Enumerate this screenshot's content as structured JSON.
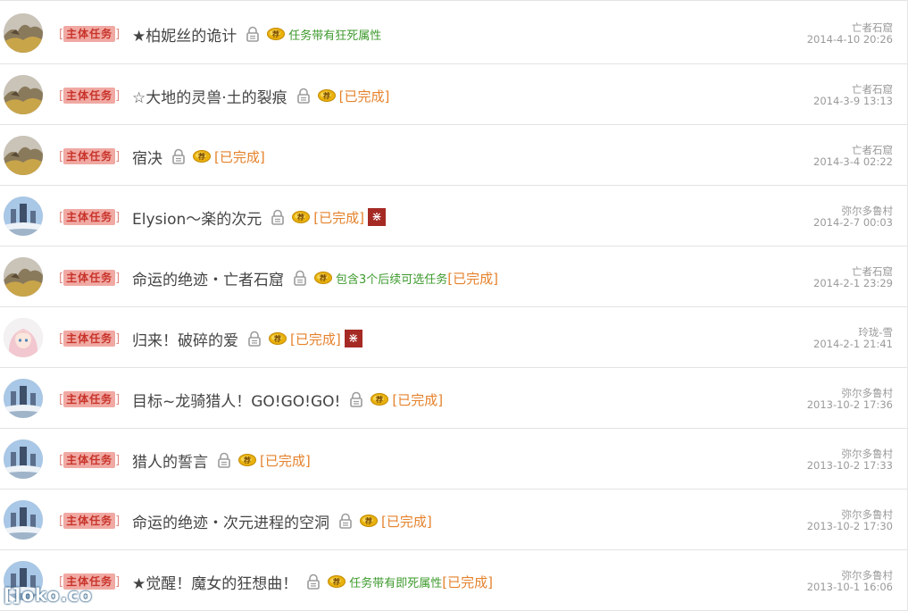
{
  "quests": [
    {
      "tag": "主体任务",
      "title": "★柏妮丝的诡计",
      "note": "任务带有狂死属性",
      "done": "",
      "flag": "",
      "location": "亡者石窟",
      "date": "2014-4-10 20:26",
      "avatar": "rock"
    },
    {
      "tag": "主体任务",
      "title": "☆大地的灵兽·土的裂痕",
      "note": "",
      "done": "[已完成]",
      "flag": "",
      "location": "亡者石窟",
      "date": "2014-3-9 13:13",
      "avatar": "rock"
    },
    {
      "tag": "主体任务",
      "title": "宿决",
      "note": "",
      "done": "[已完成]",
      "flag": "",
      "location": "亡者石窟",
      "date": "2014-3-4 02:22",
      "avatar": "rock"
    },
    {
      "tag": "主体任务",
      "title": "Elysion～楽的次元",
      "note": "",
      "done": "[已完成]",
      "flag": "⋇",
      "location": "弥尔多鲁村",
      "date": "2014-2-7 00:03",
      "avatar": "castle"
    },
    {
      "tag": "主体任务",
      "title": "命运的绝迹・亡者石窟",
      "note": "包含3个后续可选任务",
      "done": "[已完成]",
      "flag": "",
      "location": "亡者石窟",
      "date": "2014-2-1 23:29",
      "avatar": "rock"
    },
    {
      "tag": "主体任务",
      "title": "归来！破碎的爱",
      "note": "",
      "done": "[已完成]",
      "flag": "⋇",
      "location": "玲珑-雪",
      "date": "2014-2-1 21:41",
      "avatar": "girl"
    },
    {
      "tag": "主体任务",
      "title": "目标~龙骑猎人！GO!GO!GO!",
      "note": "",
      "done": "[已完成]",
      "flag": "",
      "location": "弥尔多鲁村",
      "date": "2013-10-2 17:36",
      "avatar": "castle"
    },
    {
      "tag": "主体任务",
      "title": "猎人的誓言",
      "note": "",
      "done": "[已完成]",
      "flag": "",
      "location": "弥尔多鲁村",
      "date": "2013-10-2 17:33",
      "avatar": "castle"
    },
    {
      "tag": "主体任务",
      "title": "命运的绝迹・次元进程的空洞",
      "note": "",
      "done": "[已完成]",
      "flag": "",
      "location": "弥尔多鲁村",
      "date": "2013-10-2 17:30",
      "avatar": "castle"
    },
    {
      "tag": "主体任务",
      "title": "★觉醒！魔女的狂想曲！",
      "note": "任务带有即死属性",
      "done": "[已完成]",
      "flag": "",
      "location": "弥尔多鲁村",
      "date": "2013-10-1 16:06",
      "avatar": "castle"
    }
  ],
  "watermark": "[]oko.co",
  "colors": {
    "tag_bg": "#f0a9a3",
    "tag_text": "#c8342b",
    "note": "#3e9a2e",
    "done": "#e5822c",
    "flag": "#a52a24",
    "meta": "#9a9a9a"
  }
}
